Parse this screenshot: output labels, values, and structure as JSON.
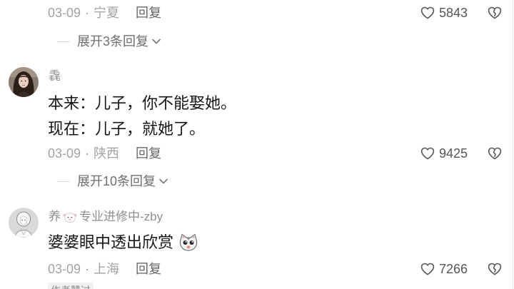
{
  "separator": "·",
  "comments": [
    {
      "date": "03-09",
      "location": "宁夏",
      "reply": "回复",
      "likes": "5843",
      "expand_replies": "展开3条回复"
    },
    {
      "username": "毳",
      "lines": [
        "本来：儿子，你不能娶她。",
        "现在：儿子，就她了。"
      ],
      "date": "03-09",
      "location": "陕西",
      "reply": "回复",
      "likes": "9425",
      "expand_replies": "展开10条回复"
    },
    {
      "username_parts": [
        "养",
        "专业进修中-zby"
      ],
      "text": "婆婆眼中透出欣赏",
      "date": "03-09",
      "location": "上海",
      "reply": "回复",
      "likes": "7266",
      "badge": "作者赞过"
    }
  ],
  "icons": {
    "like": "heart-outline-icon",
    "dislike": "broken-heart-icon",
    "expand": "chevron-down-icon",
    "username_emoji": "sheep-emoji-icon",
    "text_emoji": "cat-emoji-icon"
  },
  "colors": {
    "text_primary": "#161616",
    "text_secondary": "#a3a3a3",
    "action_text": "#666666",
    "badge_background": "#f1f1f1"
  }
}
